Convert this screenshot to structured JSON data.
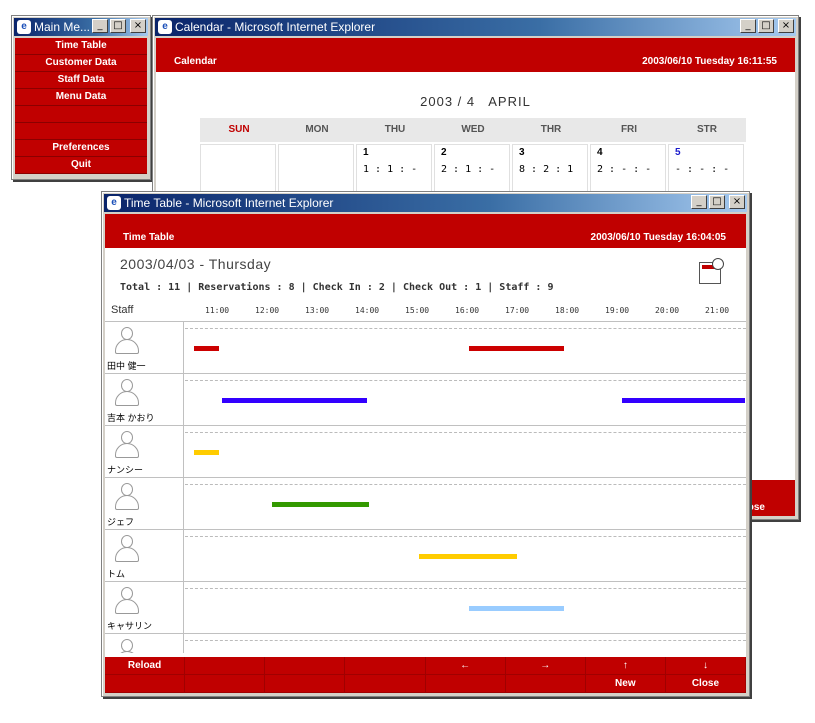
{
  "main_menu": {
    "title": "Main Me...",
    "items": [
      "Time Table",
      "Customer Data",
      "Staff Data",
      "Menu Data",
      "",
      "",
      "Preferences",
      "Quit"
    ]
  },
  "calendar": {
    "title": "Calendar - Microsoft Internet Explorer",
    "header_label": "Calendar",
    "datetime": "2003/06/10 Tuesday 16:11:55",
    "year": "2003 / 4",
    "month": "APRIL",
    "days": [
      "SUN",
      "MON",
      "THU",
      "WED",
      "THR",
      "FRI",
      "STR"
    ],
    "cells": [
      {
        "day": "",
        "stat": ""
      },
      {
        "day": "",
        "stat": ""
      },
      {
        "day": "1",
        "stat": "1 : 1 : -"
      },
      {
        "day": "2",
        "stat": "2 : 1 : -"
      },
      {
        "day": "3",
        "stat": "8 : 2 : 1"
      },
      {
        "day": "4",
        "stat": "2 : - : -"
      },
      {
        "day": "5",
        "stat": "- : - : -"
      }
    ],
    "close_label": "lose"
  },
  "timetable": {
    "title": "Time Table - Microsoft Internet Explorer",
    "header_label": "Time Table",
    "datetime": "2003/06/10 Tuesday 16:04:05",
    "date": "2003/04/03 - Thursday",
    "summary": "Total : 11 | Reservations : 8 | Check In : 2 | Check Out : 1 | Staff : 9",
    "staff_label": "Staff",
    "hours": [
      "11:00",
      "12:00",
      "13:00",
      "14:00",
      "15:00",
      "16:00",
      "17:00",
      "18:00",
      "19:00",
      "20:00",
      "21:00"
    ],
    "staff": [
      {
        "name": "田中 健一",
        "bars": [
          {
            "start": 10.5,
            "end": 11.0,
            "color": "#cc0000"
          },
          {
            "start": 16.0,
            "end": 17.9,
            "color": "#cc0000"
          }
        ]
      },
      {
        "name": "吉本 かおり",
        "bars": [
          {
            "start": 11.05,
            "end": 13.95,
            "color": "#3300ff"
          },
          {
            "start": 19.05,
            "end": 21.7,
            "color": "#3300ff"
          }
        ]
      },
      {
        "name": "ナンシー",
        "bars": [
          {
            "start": 10.5,
            "end": 11.0,
            "color": "#ffcc00"
          }
        ]
      },
      {
        "name": "ジェフ",
        "bars": [
          {
            "start": 12.05,
            "end": 14.0,
            "color": "#339900"
          }
        ]
      },
      {
        "name": "トム",
        "bars": [
          {
            "start": 15.0,
            "end": 16.95,
            "color": "#ffcc00"
          }
        ]
      },
      {
        "name": "キャサリン",
        "bars": [
          {
            "start": 16.0,
            "end": 17.9,
            "color": "#99ccff"
          }
        ]
      },
      {
        "name": "",
        "bars": []
      }
    ],
    "footer_top": [
      "Reload",
      "",
      "",
      "",
      "←",
      "→",
      "↑",
      "↓"
    ],
    "footer_bottom": [
      "",
      "",
      "",
      "",
      "",
      "",
      "New",
      "Close"
    ]
  }
}
